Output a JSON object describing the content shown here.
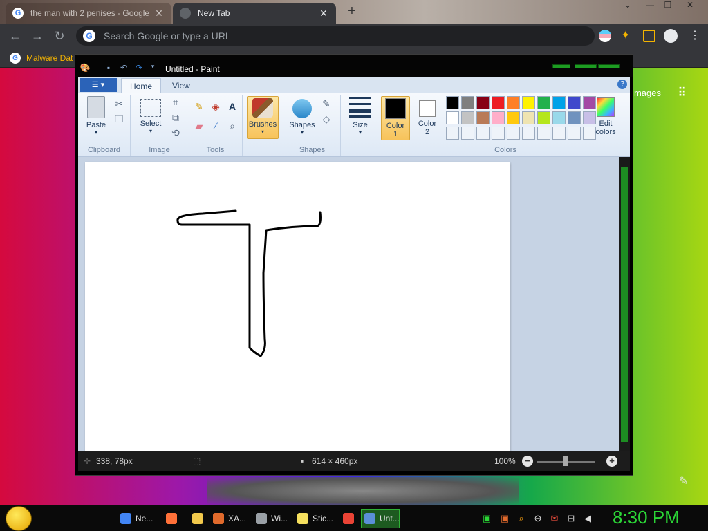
{
  "browser": {
    "tabs": [
      {
        "title": "the man with 2 penises - Google",
        "close": "✕",
        "favicon": "G"
      },
      {
        "title": "New Tab",
        "close": "✕",
        "favicon": ""
      }
    ],
    "new_tab": "+",
    "omnibox_placeholder": "Search Google or type a URL",
    "bookmark": "Malware Dat",
    "images_link": "mages",
    "window_controls": {
      "collapse": "⌄",
      "minimize": "—",
      "restore": "❐",
      "close": "✕"
    }
  },
  "paint": {
    "title": "Untitled - Paint",
    "tabs": {
      "home": "Home",
      "view": "View"
    },
    "groups": {
      "clipboard": "Clipboard",
      "image": "Image",
      "tools": "Tools",
      "shapes": "Shapes",
      "colors": "Colors"
    },
    "buttons": {
      "paste": "Paste",
      "select": "Select",
      "brushes": "Brushes",
      "shapes": "Shapes",
      "size": "Size",
      "color1": "Color",
      "color1_num": "1",
      "color2": "Color",
      "color2_num": "2",
      "edit_colors": "Edit",
      "edit_colors2": "colors"
    },
    "palette_row1": [
      "#000000",
      "#7f7f7f",
      "#880015",
      "#ed1c24",
      "#ff7f27",
      "#fff200",
      "#22b14c",
      "#00a2e8",
      "#3f48cc",
      "#a349a4"
    ],
    "palette_row2": [
      "#ffffff",
      "#c3c3c3",
      "#b97a57",
      "#ffaec9",
      "#ffc90e",
      "#efe4b0",
      "#b5e61d",
      "#99d9ea",
      "#7092be",
      "#c8bfe7"
    ],
    "status": {
      "cursor": "338, 78px",
      "size": "614 × 460px",
      "zoom": "100%"
    }
  },
  "taskbar": {
    "items": [
      {
        "label": "Ne...",
        "color": "#4285f4"
      },
      {
        "label": "",
        "color": "#ff7139"
      },
      {
        "label": "",
        "color": "#f2c94c"
      },
      {
        "label": "XA...",
        "color": "#e06a2c"
      },
      {
        "label": "Wi...",
        "color": "#9aa0a6"
      },
      {
        "label": "Stic...",
        "color": "#f6e05e"
      },
      {
        "label": "",
        "color": "#ea4335"
      },
      {
        "label": "Unt...",
        "color": "#5b8fd8"
      }
    ],
    "clock": "8:30 PM"
  }
}
